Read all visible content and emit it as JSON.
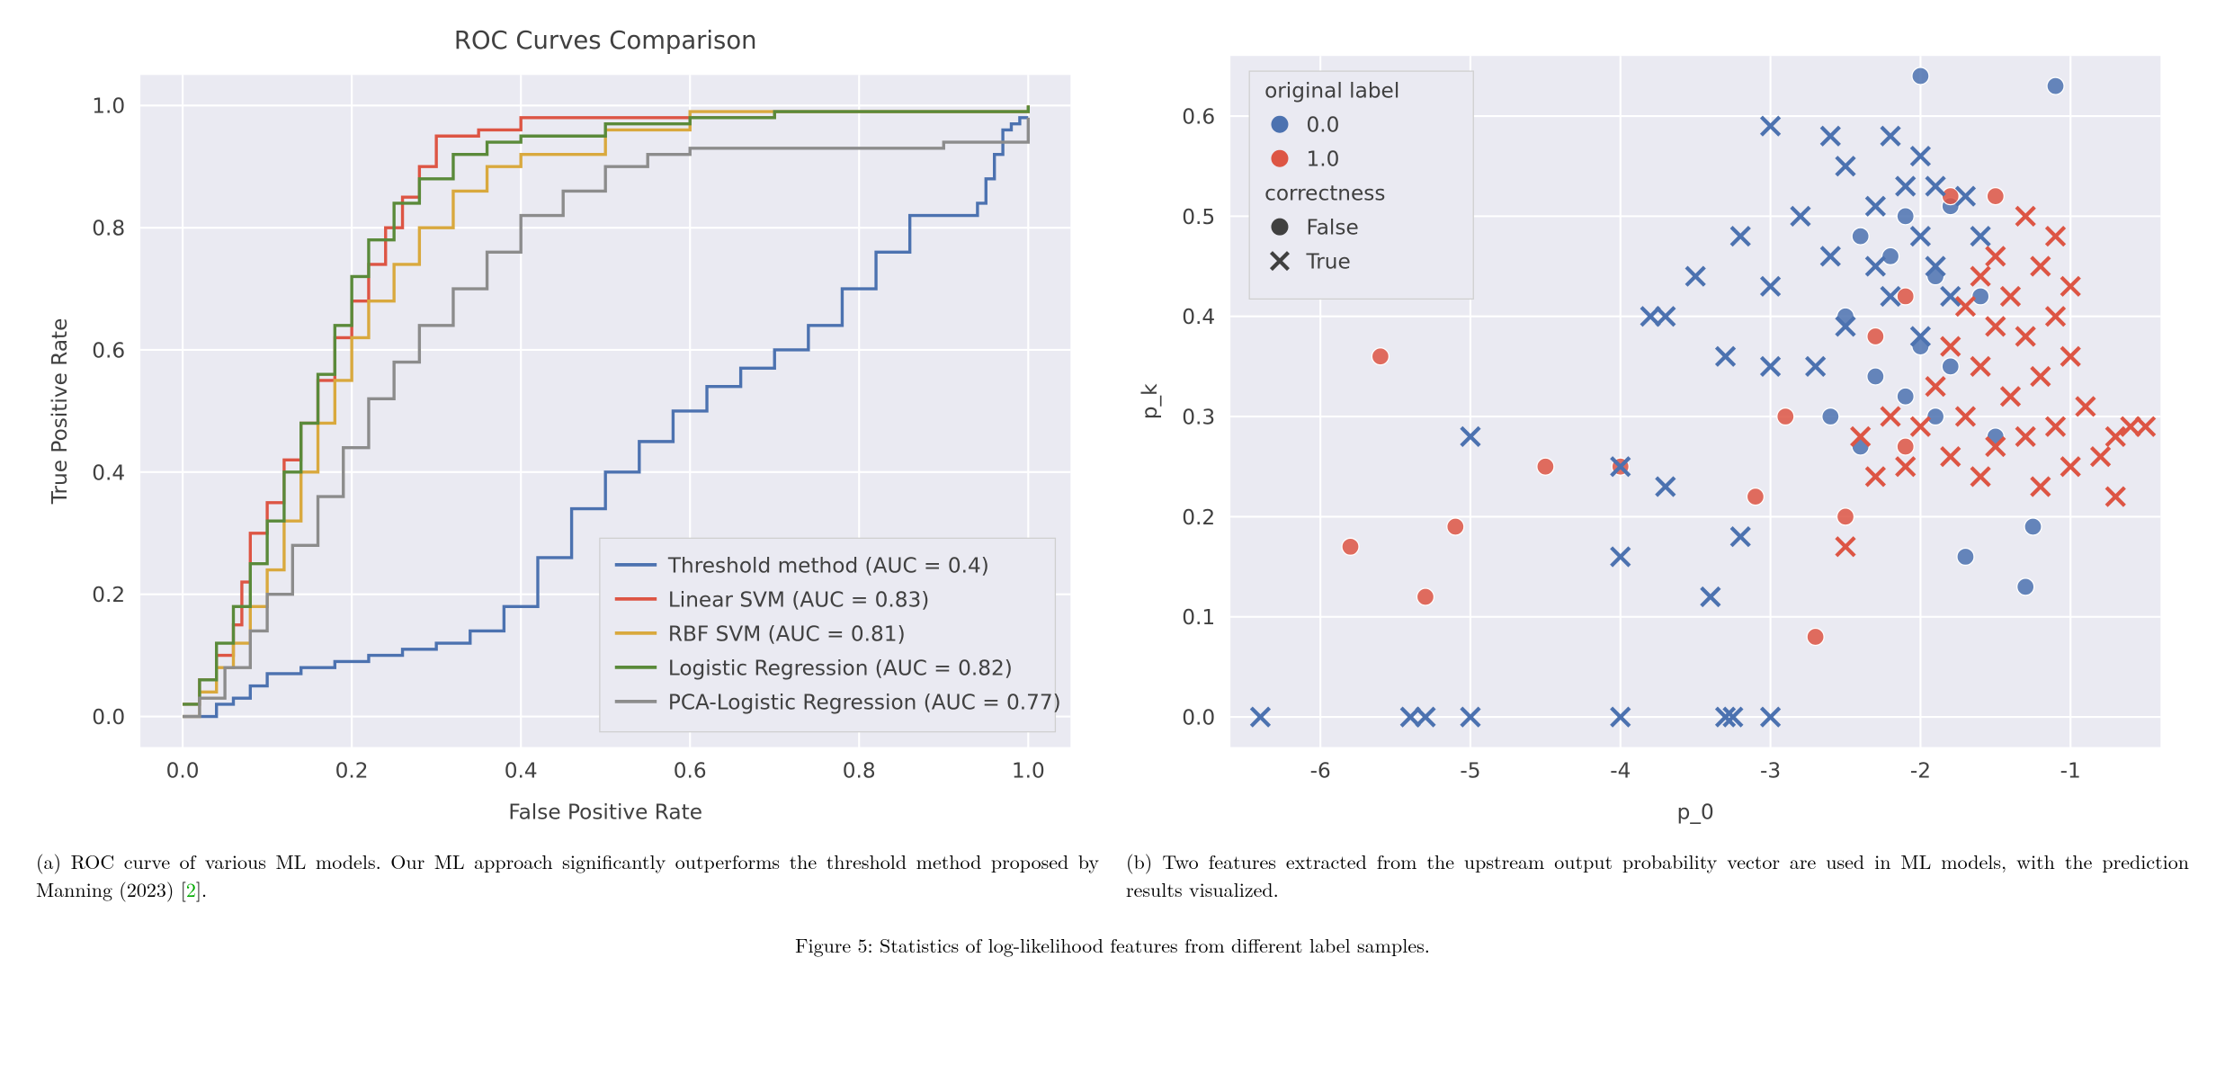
{
  "figure_number": "Figure 5:",
  "main_caption": "Statistics of log-likelihood features from different label samples.",
  "sub_a": {
    "label": "(a)",
    "caption_prefix": "ROC curve of various ML models.  Our ML approach significantly outperforms the threshold method proposed by Manning (2023) [",
    "cite": "2",
    "caption_suffix": "]."
  },
  "sub_b": {
    "label": "(b)",
    "caption": "Two features extracted from the upstream output probability vector are used in ML models, with the prediction results visualized."
  },
  "chart_data": [
    {
      "id": "roc",
      "type": "line",
      "title": "ROC Curves Comparison",
      "xlabel": "False Positive Rate",
      "ylabel": "True Positive Rate",
      "xlim": [
        -0.05,
        1.05
      ],
      "ylim": [
        -0.05,
        1.05
      ],
      "xticks": [
        0.0,
        0.2,
        0.4,
        0.6,
        0.8,
        1.0
      ],
      "yticks": [
        0.0,
        0.2,
        0.4,
        0.6,
        0.8,
        1.0
      ],
      "legend_position": "lower-right",
      "series": [
        {
          "name": "Threshold method (AUC = 0.4)",
          "color": "#4c72b0",
          "x": [
            0.0,
            0.02,
            0.04,
            0.06,
            0.08,
            0.1,
            0.14,
            0.18,
            0.22,
            0.26,
            0.3,
            0.34,
            0.38,
            0.42,
            0.46,
            0.5,
            0.54,
            0.58,
            0.62,
            0.66,
            0.7,
            0.74,
            0.78,
            0.82,
            0.86,
            0.9,
            0.92,
            0.94,
            0.95,
            0.96,
            0.97,
            0.98,
            0.99,
            1.0
          ],
          "y": [
            0.0,
            0.0,
            0.02,
            0.03,
            0.05,
            0.07,
            0.08,
            0.09,
            0.1,
            0.11,
            0.12,
            0.14,
            0.18,
            0.26,
            0.34,
            0.4,
            0.45,
            0.5,
            0.54,
            0.57,
            0.6,
            0.64,
            0.7,
            0.76,
            0.82,
            0.82,
            0.82,
            0.84,
            0.88,
            0.92,
            0.96,
            0.97,
            0.98,
            0.98
          ]
        },
        {
          "name": "Linear SVM (AUC = 0.83)",
          "color": "#dd5544",
          "x": [
            0.0,
            0.02,
            0.04,
            0.06,
            0.07,
            0.08,
            0.1,
            0.12,
            0.14,
            0.16,
            0.18,
            0.2,
            0.22,
            0.24,
            0.26,
            0.28,
            0.3,
            0.35,
            0.4,
            0.5,
            0.6,
            0.7,
            0.8,
            0.9,
            1.0
          ],
          "y": [
            0.02,
            0.06,
            0.1,
            0.15,
            0.22,
            0.3,
            0.35,
            0.42,
            0.48,
            0.55,
            0.62,
            0.68,
            0.74,
            0.8,
            0.85,
            0.9,
            0.95,
            0.96,
            0.98,
            0.98,
            0.98,
            0.99,
            0.99,
            0.99,
            1.0
          ]
        },
        {
          "name": "RBF SVM (AUC = 0.81)",
          "color": "#d9a93e",
          "x": [
            0.0,
            0.02,
            0.04,
            0.06,
            0.08,
            0.1,
            0.12,
            0.14,
            0.16,
            0.18,
            0.2,
            0.22,
            0.25,
            0.28,
            0.32,
            0.36,
            0.4,
            0.5,
            0.6,
            0.7,
            0.8,
            0.9,
            1.0
          ],
          "y": [
            0.0,
            0.04,
            0.08,
            0.12,
            0.18,
            0.24,
            0.32,
            0.4,
            0.48,
            0.55,
            0.62,
            0.68,
            0.74,
            0.8,
            0.86,
            0.9,
            0.92,
            0.96,
            0.99,
            0.99,
            0.99,
            0.99,
            1.0
          ]
        },
        {
          "name": "Logistic Regression (AUC = 0.82)",
          "color": "#5a8a3a",
          "x": [
            0.0,
            0.02,
            0.04,
            0.06,
            0.08,
            0.1,
            0.12,
            0.14,
            0.16,
            0.18,
            0.2,
            0.22,
            0.25,
            0.28,
            0.32,
            0.36,
            0.4,
            0.5,
            0.6,
            0.7,
            0.8,
            0.9,
            1.0
          ],
          "y": [
            0.02,
            0.06,
            0.12,
            0.18,
            0.25,
            0.32,
            0.4,
            0.48,
            0.56,
            0.64,
            0.72,
            0.78,
            0.84,
            0.88,
            0.92,
            0.94,
            0.95,
            0.97,
            0.98,
            0.99,
            0.99,
            0.99,
            1.0
          ]
        },
        {
          "name": "PCA-Logistic Regression (AUC = 0.77)",
          "color": "#8c8c8c",
          "x": [
            0.0,
            0.02,
            0.05,
            0.08,
            0.1,
            0.13,
            0.16,
            0.19,
            0.22,
            0.25,
            0.28,
            0.32,
            0.36,
            0.4,
            0.45,
            0.5,
            0.55,
            0.6,
            0.7,
            0.8,
            0.9,
            1.0
          ],
          "y": [
            0.0,
            0.03,
            0.08,
            0.14,
            0.2,
            0.28,
            0.36,
            0.44,
            0.52,
            0.58,
            0.64,
            0.7,
            0.76,
            0.82,
            0.86,
            0.9,
            0.92,
            0.93,
            0.93,
            0.93,
            0.94,
            0.98
          ]
        }
      ]
    },
    {
      "id": "scatter",
      "type": "scatter",
      "title": "",
      "xlabel": "p_0",
      "ylabel": "p_k",
      "xlim": [
        -6.6,
        -0.4
      ],
      "ylim": [
        -0.03,
        0.66
      ],
      "xticks": [
        -6,
        -5,
        -4,
        -3,
        -2,
        -1
      ],
      "yticks": [
        0.0,
        0.1,
        0.2,
        0.3,
        0.4,
        0.5,
        0.6
      ],
      "legend": {
        "group1_title": "original label",
        "group1_items": [
          {
            "label": "0.0",
            "color": "#4c72b0"
          },
          {
            "label": "1.0",
            "color": "#dd5544"
          }
        ],
        "group2_title": "correctness",
        "group2_items": [
          {
            "label": "False",
            "marker": "circle"
          },
          {
            "label": "True",
            "marker": "x"
          }
        ]
      },
      "points": {
        "blue_circle": [
          [
            -2.0,
            0.64
          ],
          [
            -1.1,
            0.63
          ],
          [
            -1.8,
            0.51
          ],
          [
            -2.1,
            0.5
          ],
          [
            -2.4,
            0.48
          ],
          [
            -2.2,
            0.46
          ],
          [
            -1.9,
            0.44
          ],
          [
            -1.6,
            0.42
          ],
          [
            -2.5,
            0.4
          ],
          [
            -2.0,
            0.37
          ],
          [
            -1.8,
            0.35
          ],
          [
            -2.3,
            0.34
          ],
          [
            -2.1,
            0.32
          ],
          [
            -1.9,
            0.3
          ],
          [
            -2.6,
            0.3
          ],
          [
            -1.5,
            0.28
          ],
          [
            -2.4,
            0.27
          ],
          [
            -1.25,
            0.19
          ],
          [
            -1.7,
            0.16
          ],
          [
            -1.3,
            0.13
          ]
        ],
        "blue_x": [
          [
            -3.0,
            0.59
          ],
          [
            -2.6,
            0.58
          ],
          [
            -2.2,
            0.58
          ],
          [
            -2.0,
            0.56
          ],
          [
            -2.5,
            0.55
          ],
          [
            -2.1,
            0.53
          ],
          [
            -1.9,
            0.53
          ],
          [
            -1.7,
            0.52
          ],
          [
            -2.3,
            0.51
          ],
          [
            -2.8,
            0.5
          ],
          [
            -3.2,
            0.48
          ],
          [
            -2.0,
            0.48
          ],
          [
            -1.6,
            0.48
          ],
          [
            -2.6,
            0.46
          ],
          [
            -2.3,
            0.45
          ],
          [
            -1.9,
            0.45
          ],
          [
            -3.5,
            0.44
          ],
          [
            -3.0,
            0.43
          ],
          [
            -2.2,
            0.42
          ],
          [
            -1.8,
            0.42
          ],
          [
            -3.8,
            0.4
          ],
          [
            -3.7,
            0.4
          ],
          [
            -2.5,
            0.39
          ],
          [
            -2.0,
            0.38
          ],
          [
            -3.3,
            0.36
          ],
          [
            -3.0,
            0.35
          ],
          [
            -2.7,
            0.35
          ],
          [
            -5.0,
            0.28
          ],
          [
            -4.0,
            0.25
          ],
          [
            -3.7,
            0.23
          ],
          [
            -4.0,
            0.16
          ],
          [
            -3.4,
            0.12
          ],
          [
            -3.2,
            0.18
          ],
          [
            -6.4,
            0.0
          ],
          [
            -5.4,
            0.0
          ],
          [
            -5.3,
            0.0
          ],
          [
            -5.0,
            0.0
          ],
          [
            -4.0,
            0.0
          ],
          [
            -3.3,
            0.0
          ],
          [
            -3.25,
            0.0
          ],
          [
            -3.0,
            0.0
          ]
        ],
        "red_circle": [
          [
            -1.8,
            0.52
          ],
          [
            -1.5,
            0.52
          ],
          [
            -2.1,
            0.42
          ],
          [
            -2.3,
            0.38
          ],
          [
            -5.6,
            0.36
          ],
          [
            -4.5,
            0.25
          ],
          [
            -4.0,
            0.25
          ],
          [
            -5.8,
            0.17
          ],
          [
            -5.1,
            0.19
          ],
          [
            -5.3,
            0.12
          ],
          [
            -3.1,
            0.22
          ],
          [
            -2.7,
            0.08
          ],
          [
            -2.5,
            0.2
          ],
          [
            -2.9,
            0.3
          ],
          [
            -2.1,
            0.27
          ]
        ],
        "red_x": [
          [
            -1.3,
            0.5
          ],
          [
            -1.1,
            0.48
          ],
          [
            -1.5,
            0.46
          ],
          [
            -1.2,
            0.45
          ],
          [
            -1.6,
            0.44
          ],
          [
            -1.0,
            0.43
          ],
          [
            -1.4,
            0.42
          ],
          [
            -1.7,
            0.41
          ],
          [
            -1.1,
            0.4
          ],
          [
            -1.5,
            0.39
          ],
          [
            -1.3,
            0.38
          ],
          [
            -1.8,
            0.37
          ],
          [
            -1.0,
            0.36
          ],
          [
            -1.6,
            0.35
          ],
          [
            -1.2,
            0.34
          ],
          [
            -1.9,
            0.33
          ],
          [
            -1.4,
            0.32
          ],
          [
            -0.9,
            0.31
          ],
          [
            -1.7,
            0.3
          ],
          [
            -1.1,
            0.29
          ],
          [
            -2.0,
            0.29
          ],
          [
            -1.3,
            0.28
          ],
          [
            -0.5,
            0.29
          ],
          [
            -1.5,
            0.27
          ],
          [
            -0.7,
            0.28
          ],
          [
            -0.8,
            0.26
          ],
          [
            -1.8,
            0.26
          ],
          [
            -1.0,
            0.25
          ],
          [
            -1.6,
            0.24
          ],
          [
            -1.2,
            0.23
          ],
          [
            -0.6,
            0.29
          ],
          [
            -0.7,
            0.22
          ],
          [
            -2.2,
            0.3
          ],
          [
            -2.4,
            0.28
          ],
          [
            -2.1,
            0.25
          ],
          [
            -2.5,
            0.17
          ],
          [
            -2.3,
            0.24
          ]
        ]
      }
    }
  ]
}
